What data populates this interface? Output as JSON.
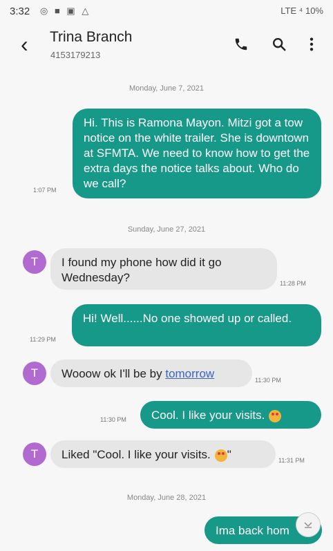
{
  "status_bar": {
    "time": "3:32",
    "right": "LTE ⁴ 10%"
  },
  "header": {
    "contact_name": "Trina Branch",
    "contact_number": "4153179213"
  },
  "dates": [
    "Monday, June 7, 2021",
    "Sunday, June 27, 2021",
    "Monday, June 28, 2021"
  ],
  "messages": [
    {
      "direction": "out",
      "text": "Hi.  This is Ramona Mayon. Mitzi got a tow notice on the white trailer.  She is downtown at SFMTA.  We need to know how to get the extra days the notice talks about.  Who do we call?",
      "time": "1:07 PM"
    },
    {
      "direction": "in",
      "avatar": "T",
      "text": "I found my phone how did it go Wednesday?",
      "time": "11:28 PM"
    },
    {
      "direction": "out",
      "text": "Hi! Well......No one showed up or called.",
      "time": "11:29 PM"
    },
    {
      "direction": "in",
      "avatar": "T",
      "text_prefix": "Wooow ok I'll be by ",
      "link": "tomorrow",
      "time": "11:30 PM"
    },
    {
      "direction": "out",
      "text": "Cool.  I like your visits.",
      "emoji": "star-struck-face",
      "time": "11:30 PM"
    },
    {
      "direction": "in",
      "avatar": "T",
      "text_prefix": "Liked \"Cool.  I like your visits.",
      "text_suffix": "\"",
      "emoji": "star-struck-face",
      "time": "11:31 PM"
    },
    {
      "direction": "out",
      "text": "Ima back hom"
    }
  ]
}
